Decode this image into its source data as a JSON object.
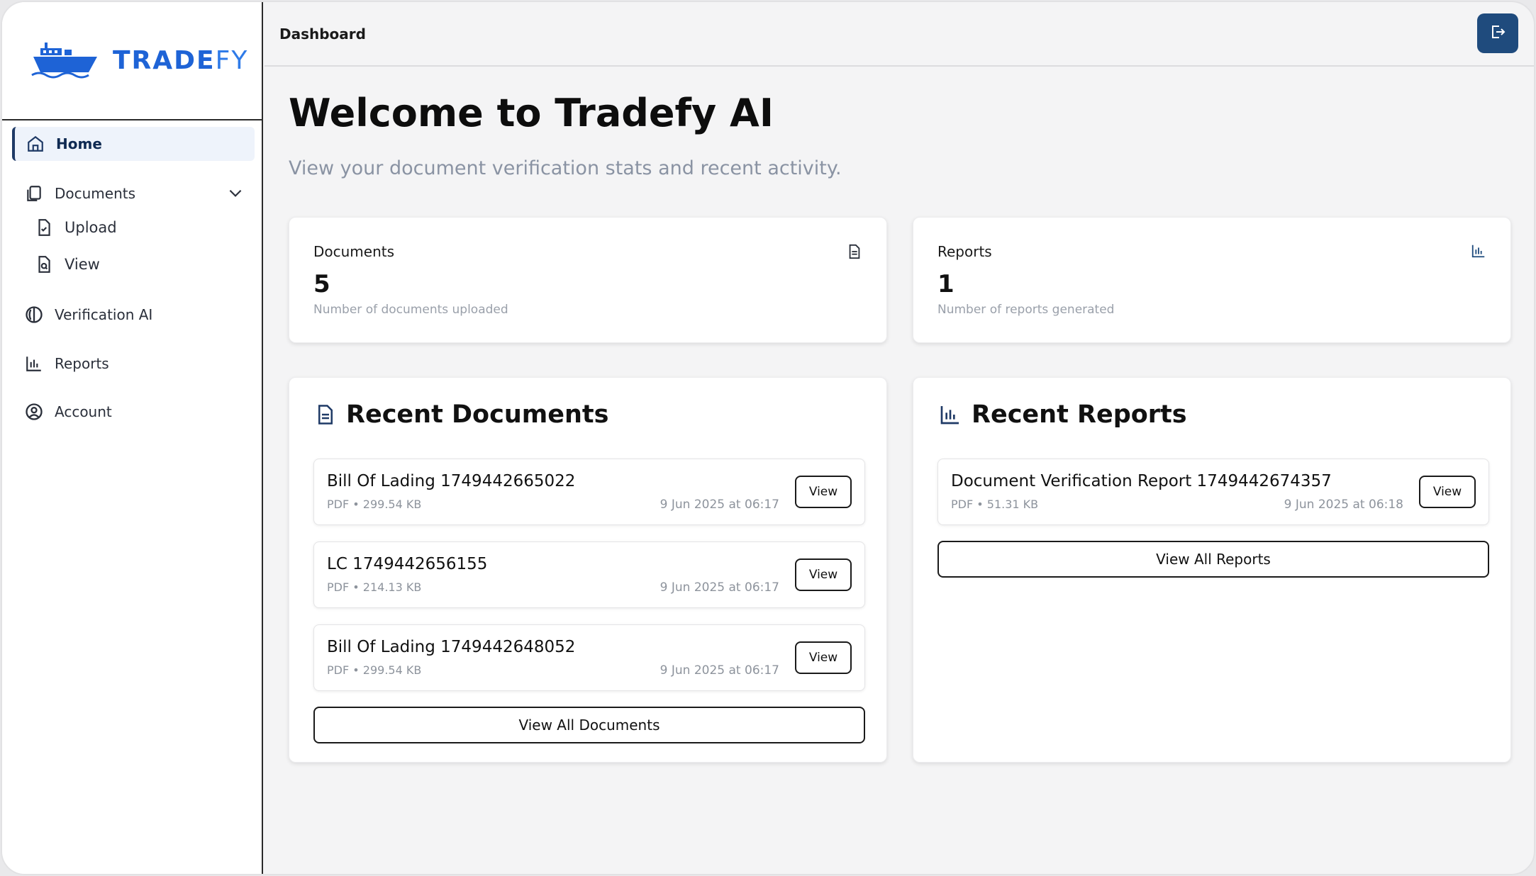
{
  "brand": {
    "name_main": "TRADE",
    "name_accent": "FY"
  },
  "sidebar": {
    "items": [
      {
        "label": "Home",
        "icon": "home-icon"
      },
      {
        "label": "Documents",
        "icon": "documents-icon"
      },
      {
        "label": "Upload",
        "icon": "upload-file-icon"
      },
      {
        "label": "View",
        "icon": "view-file-icon"
      },
      {
        "label": "Verification AI",
        "icon": "brain-icon"
      },
      {
        "label": "Reports",
        "icon": "bar-chart-icon"
      },
      {
        "label": "Account",
        "icon": "account-icon"
      }
    ]
  },
  "topbar": {
    "title": "Dashboard"
  },
  "main": {
    "welcome": "Welcome to Tradefy AI",
    "subtitle": "View your document verification stats and recent activity."
  },
  "stats": {
    "documents": {
      "label": "Documents",
      "value": "5",
      "desc": "Number of documents uploaded"
    },
    "reports": {
      "label": "Reports",
      "value": "1",
      "desc": "Number of reports generated"
    }
  },
  "recent_documents": {
    "title": "Recent Documents",
    "items": [
      {
        "name": "Bill Of Lading 1749442665022",
        "meta": "PDF • 299.54 KB",
        "date": "9 Jun 2025 at 06:17",
        "action": "View"
      },
      {
        "name": "LC 1749442656155",
        "meta": "PDF • 214.13 KB",
        "date": "9 Jun 2025 at 06:17",
        "action": "View"
      },
      {
        "name": "Bill Of Lading 1749442648052",
        "meta": "PDF • 299.54 KB",
        "date": "9 Jun 2025 at 06:17",
        "action": "View"
      }
    ],
    "view_all": "View All Documents"
  },
  "recent_reports": {
    "title": "Recent Reports",
    "items": [
      {
        "name": "Document Verification Report 1749442674357",
        "meta": "PDF • 51.31 KB",
        "date": "9 Jun 2025 at 06:18",
        "action": "View"
      }
    ],
    "view_all": "View All Reports"
  },
  "colors": {
    "brand": "#1e63d6",
    "accent": "#1f4b7d",
    "active_nav_bg": "#eef3fb"
  }
}
